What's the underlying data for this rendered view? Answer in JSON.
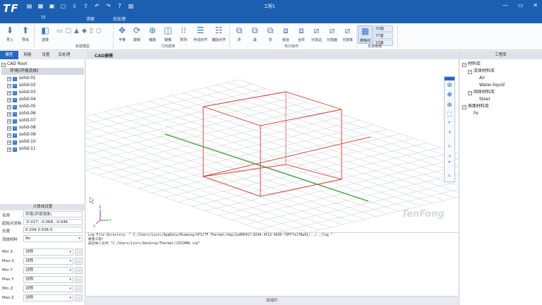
{
  "window": {
    "title": "工程1",
    "logo_text": "TF-Thermal"
  },
  "menu": {
    "tabs": [
      "TF",
      "求解",
      "后处理"
    ]
  },
  "ribbon": {
    "buttons": [
      {
        "label": "导入"
      },
      {
        "label": "导出"
      },
      {
        "label": "选择"
      },
      {
        "label": "平移"
      },
      {
        "label": "旋转"
      },
      {
        "label": "缩放"
      },
      {
        "label": "镜像"
      },
      {
        "label": "阵列"
      },
      {
        "label": "手动对齐"
      },
      {
        "label": "捕捉对齐"
      },
      {
        "label": "并"
      },
      {
        "label": "减"
      },
      {
        "label": "交"
      },
      {
        "label": "组合"
      },
      {
        "label": "合并"
      },
      {
        "label": "分割边"
      },
      {
        "label": "分割面"
      },
      {
        "label": "分割体"
      },
      {
        "label": "栅格线"
      }
    ],
    "groups": [
      "新建模型",
      "几何变换",
      "布尔操作",
      "背景栅格"
    ],
    "planes": [
      "XZ面",
      "XY面",
      "YZ面"
    ]
  },
  "left_panel": {
    "tabs": [
      "模型",
      "网格",
      "设置",
      "后处理"
    ],
    "tree_root": "CAD Root",
    "environment": "环境(环境流体)",
    "solids": [
      "solid-01",
      "solid-02",
      "solid-03",
      "solid-04",
      "solid-05",
      "solid-06",
      "solid-07",
      "solid-08",
      "solid-09",
      "solid-10",
      "solid-11"
    ]
  },
  "compute_domain": {
    "header": "计算域设置",
    "name_label": "名称",
    "name_value": "环境(环境流体)",
    "start_label": "起始点坐标",
    "start_value": "-0.027, -0.068, -0.046",
    "length_label": "长度",
    "length_value": "0.204 0.036 0",
    "fluid_label": "流体材料",
    "fluid_value": "Air",
    "bounds": [
      {
        "label": "Min X",
        "value": "对称"
      },
      {
        "label": "Max X",
        "value": "对称"
      },
      {
        "label": "Min Y",
        "value": "对称"
      },
      {
        "label": "Max Y",
        "value": "对称"
      },
      {
        "label": "Min Z",
        "value": "对称"
      },
      {
        "label": "Max Z",
        "value": "对称"
      }
    ],
    "more_label": "..."
  },
  "viewport": {
    "title": "CAD建模",
    "watermark": "TenFong"
  },
  "console": {
    "lines": [
      "Log File Directory: \" C:/Users/Lcorc/AppData/Roaming/GFS/TF-Thermal/tmp/2a4DD417-8246-4f13-9036-79FF7e17Ba91/../../log \"",
      "新建工程!",
      "成功导入文件 \"C:/Users/Lcorc/Desktop/Thermal/JIXIAMG.stp\""
    ]
  },
  "status": {
    "text": "就绪栏"
  },
  "right_panel": {
    "title": "工程库",
    "tree": [
      {
        "label": "材料库",
        "level": 0,
        "box": "−"
      },
      {
        "label": "流体材料库",
        "level": 1,
        "box": "−"
      },
      {
        "label": "Air",
        "level": 2,
        "box": ""
      },
      {
        "label": "Water-liquid",
        "level": 2,
        "box": ""
      },
      {
        "label": "固体材料库",
        "level": 1,
        "box": "−"
      },
      {
        "label": "Steel",
        "level": 2,
        "box": ""
      },
      {
        "label": "表面材料库",
        "level": 0,
        "box": "−"
      },
      {
        "label": "Fe",
        "level": 1,
        "box": ""
      }
    ]
  }
}
